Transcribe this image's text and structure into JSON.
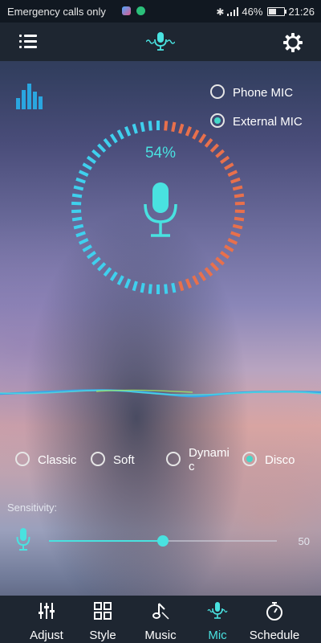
{
  "status_bar": {
    "carrier_text": "Emergency calls only",
    "battery_text": "46%",
    "time": "21:26",
    "battery_level": 0.46
  },
  "header": {
    "menu_icon": "list-menu-icon",
    "logo_icon": "mic-wave-logo-icon",
    "settings_icon": "gear-icon"
  },
  "mic_source": {
    "options": [
      {
        "label": "Phone MIC",
        "selected": false
      },
      {
        "label": "External MIC",
        "selected": true
      }
    ]
  },
  "level_meter": {
    "percent_text": "54%",
    "level": 0.54,
    "active_color": "#3fd0ee",
    "inactive_color": "#e8704c"
  },
  "modes": {
    "options": [
      {
        "label": "Classic",
        "selected": false
      },
      {
        "label": "Soft",
        "selected": false
      },
      {
        "label": "Dynamic",
        "selected": false
      },
      {
        "label": "Disco",
        "selected": true
      }
    ]
  },
  "sensitivity": {
    "label": "Sensitivity:",
    "value": 50,
    "value_text": "50",
    "max": 100
  },
  "nav": {
    "items": [
      {
        "label": "Adjust",
        "icon": "sliders-icon",
        "active": false
      },
      {
        "label": "Style",
        "icon": "grid-icon",
        "active": false
      },
      {
        "label": "Music",
        "icon": "music-note-icon",
        "active": false
      },
      {
        "label": "Mic",
        "icon": "mic-icon",
        "active": true
      },
      {
        "label": "Schedule",
        "icon": "stopwatch-icon",
        "active": false
      }
    ]
  },
  "colors": {
    "accent": "#49e2e0",
    "bar_background": "#1e2631"
  }
}
